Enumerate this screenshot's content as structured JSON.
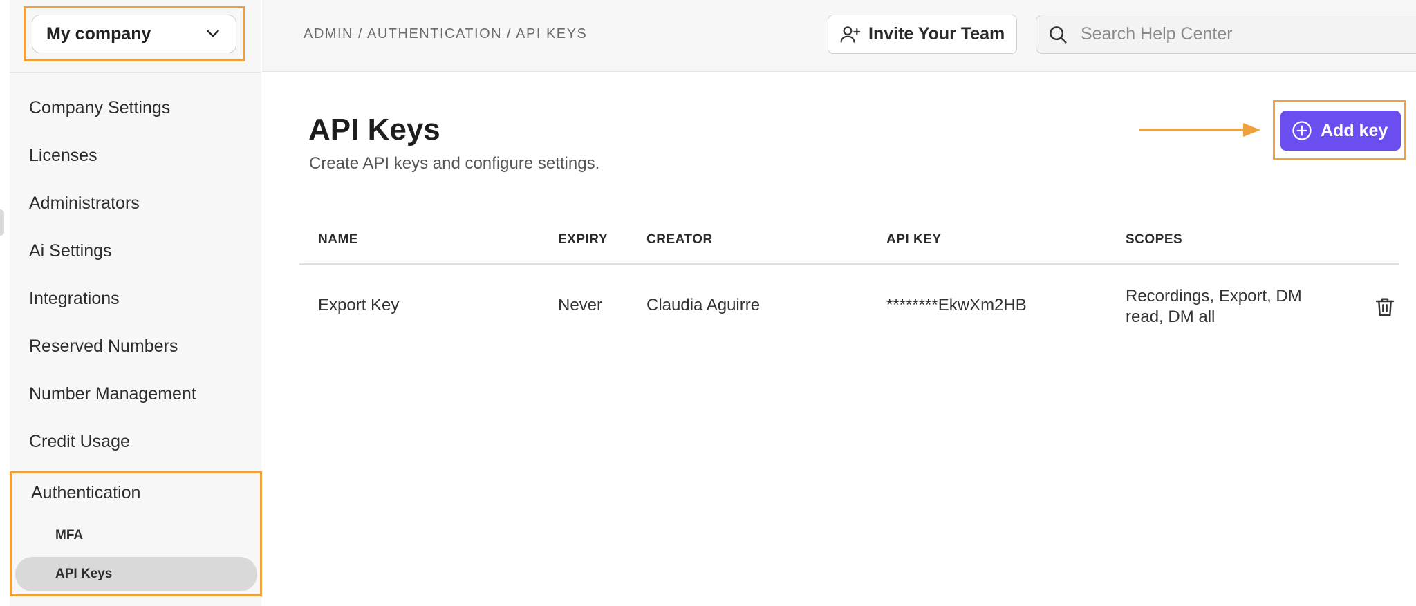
{
  "sidebar": {
    "company": "My company",
    "items": [
      {
        "label": "Company Settings"
      },
      {
        "label": "Licenses"
      },
      {
        "label": "Administrators"
      },
      {
        "label": "Ai Settings"
      },
      {
        "label": "Integrations"
      },
      {
        "label": "Reserved Numbers"
      },
      {
        "label": "Number Management"
      },
      {
        "label": "Credit Usage"
      }
    ],
    "authentication": {
      "label": "Authentication",
      "sub_items": [
        {
          "label": "MFA"
        },
        {
          "label": "API Keys",
          "active": true
        }
      ]
    }
  },
  "header": {
    "breadcrumb": "ADMIN / AUTHENTICATION / API KEYS",
    "invite_label": "Invite Your Team",
    "search_placeholder": "Search Help Center"
  },
  "main": {
    "title": "API Keys",
    "subtitle": "Create API keys and configure settings.",
    "add_label": "Add key",
    "table": {
      "columns": [
        "NAME",
        "EXPIRY",
        "CREATOR",
        "API KEY",
        "SCOPES"
      ],
      "rows": [
        {
          "name": "Export Key",
          "expiry": "Never",
          "creator": "Claudia Aguirre",
          "api_key": "********EkwXm2HB",
          "scopes": "Recordings, Export, DM read, DM all"
        }
      ]
    }
  },
  "colors": {
    "accent": "#6c4df0",
    "highlight": "#f0a13c",
    "active_item": "#d9d9d9"
  },
  "icons": [
    "chevron-down-icon",
    "user-plus-icon",
    "search-icon",
    "plus-circle-icon",
    "trash-icon",
    "arrow-right-icon"
  ]
}
